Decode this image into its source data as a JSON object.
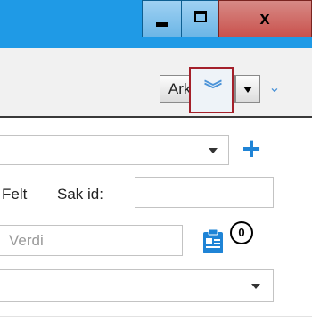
{
  "window": {
    "minimize_label": "_",
    "maximize_label": "□",
    "close_label": "x"
  },
  "toolbar": {
    "archive_search_label": "Arkivsøk",
    "expand_icon": "double-chevron-down-icon",
    "more_icon": "chevron-down-icon"
  },
  "form": {
    "add_button_label": "+",
    "field_label": "Felt",
    "case_id_label": "Sak id:",
    "case_id_value": "",
    "value_placeholder": "Verdi",
    "value_value": "",
    "badge_count": "0"
  },
  "colors": {
    "titlebar": "#1f9ae6",
    "close_button": "#c9524d",
    "accent": "#1f84d6",
    "highlight_border": "#a4202a"
  }
}
